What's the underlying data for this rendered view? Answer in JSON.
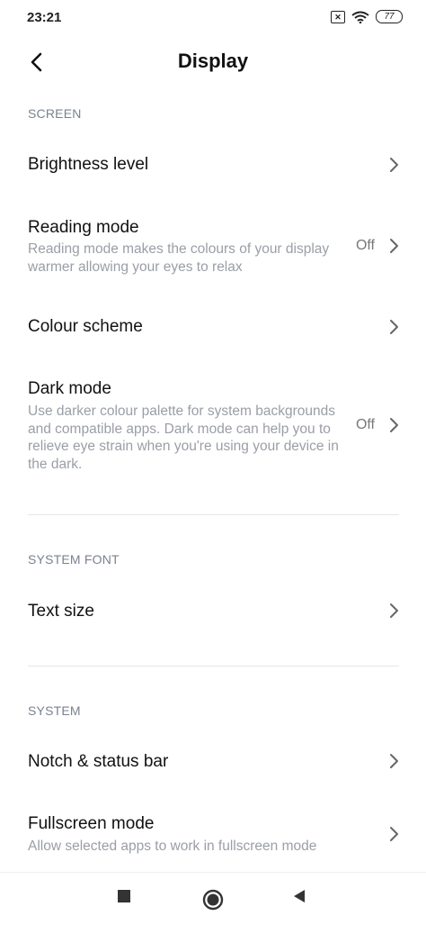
{
  "status_bar": {
    "time": "23:21",
    "sim_icon": "sim-x-icon",
    "battery": "77"
  },
  "header": {
    "title": "Display",
    "back_icon": "back-arrow-icon"
  },
  "sections": {
    "screen": {
      "label": "SCREEN",
      "brightness": {
        "title": "Brightness level"
      },
      "reading_mode": {
        "title": "Reading mode",
        "description": "Reading mode makes the colours of your display warmer allowing your eyes to relax",
        "value": "Off"
      },
      "colour_scheme": {
        "title": "Colour scheme"
      },
      "dark_mode": {
        "title": "Dark mode",
        "description": "Use darker colour palette for system backgrounds and compatible apps. Dark mode can help you to relieve eye strain when you're using your device in the dark.",
        "value": "Off"
      }
    },
    "system_font": {
      "label": "SYSTEM FONT",
      "text_size": {
        "title": "Text size"
      }
    },
    "system": {
      "label": "SYSTEM",
      "notch": {
        "title": "Notch & status bar"
      },
      "fullscreen": {
        "title": "Fullscreen mode",
        "description": "Allow selected apps to work in fullscreen mode"
      }
    }
  },
  "nav_bar": {
    "recents_icon": "square-icon",
    "home_icon": "circle-icon",
    "back_icon": "triangle-back-icon"
  },
  "colors": {
    "section_header": "#7a8290",
    "description": "#9a9ea6",
    "chevron": "#666666"
  }
}
